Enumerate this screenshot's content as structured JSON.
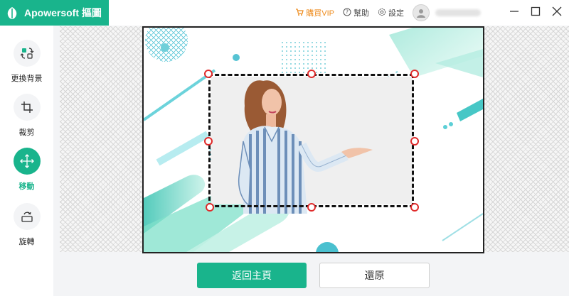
{
  "app": {
    "title": "Apowersoft 摳圖",
    "logo": "leaf-logo-icon"
  },
  "header": {
    "vip_label": "購買VIP",
    "help_label": "幫助",
    "settings_label": "設定"
  },
  "sidebar": {
    "items": [
      {
        "label": "更換背景",
        "icon": "replace-background-icon",
        "active": false
      },
      {
        "label": "裁剪",
        "icon": "crop-icon",
        "active": false
      },
      {
        "label": "移動",
        "icon": "move-icon",
        "active": true
      },
      {
        "label": "旋轉",
        "icon": "rotate-icon",
        "active": false
      }
    ]
  },
  "footer": {
    "home_button": "返回主頁",
    "restore_button": "還原"
  },
  "colors": {
    "accent": "#19b48c",
    "vip": "#ee8a1a",
    "crop_handle": "#e02b2b"
  }
}
